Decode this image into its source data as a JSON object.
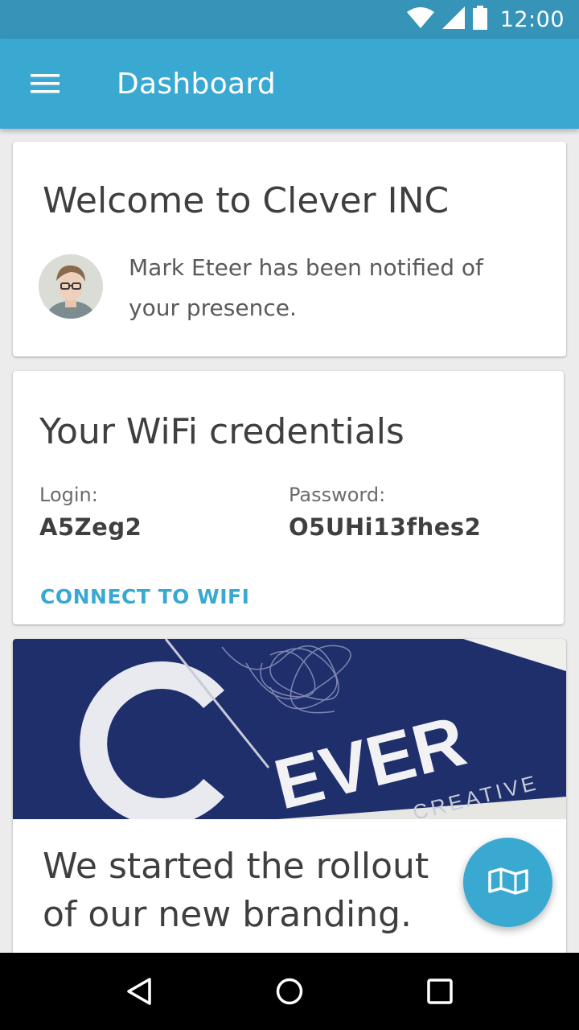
{
  "status_bar": {
    "time": "12:00",
    "icons": [
      "wifi-icon",
      "cell-signal-icon",
      "battery-icon"
    ]
  },
  "app_bar": {
    "menu_icon": "hamburger-menu-icon",
    "title": "Dashboard"
  },
  "welcome_card": {
    "title": "Welcome to Clever INC",
    "avatar_icon": "avatar",
    "message": "Mark Eteer has been notified of your presence."
  },
  "wifi_card": {
    "title": "Your WiFi credentials",
    "login_label": "Login:",
    "login_value": "A5Zeg2",
    "password_label": "Password:",
    "password_value": "O5UHi13fhes2",
    "connect_label": "CONNECT TO WIFI"
  },
  "brand_card": {
    "image_logo_text": "EVER",
    "image_sub_text": "CREATIVE",
    "text": "We started the rollout of our new branding."
  },
  "fab": {
    "icon": "map-icon"
  },
  "nav_bar": {
    "icons": [
      "back-icon",
      "home-icon",
      "recents-icon"
    ]
  },
  "colors": {
    "status_bar": "#3594b8",
    "app_bar": "#3aa9d2",
    "accent": "#3aa9d2",
    "brand_navy": "#1f2f6b"
  }
}
